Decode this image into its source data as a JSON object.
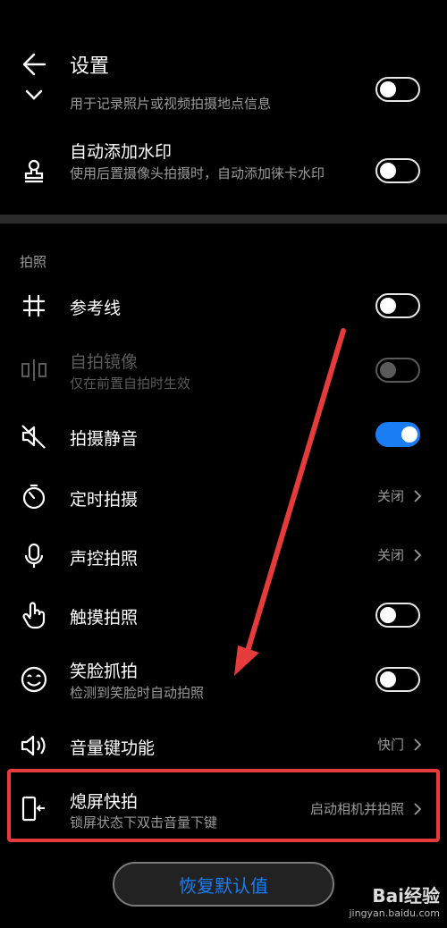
{
  "header": {
    "title": "设置"
  },
  "rows": {
    "location_sub": "用于记录照片或视频拍摄地点信息",
    "watermark": {
      "label": "自动添加水印",
      "sub": "使用后置摄像头拍摄时，自动添加徕卡水印"
    },
    "section_title": "拍照",
    "grid": {
      "label": "参考线"
    },
    "mirror": {
      "label": "自拍镜像",
      "sub": "仅在前置自拍时生效"
    },
    "mute": {
      "label": "拍摄静音"
    },
    "timer": {
      "label": "定时拍摄",
      "value": "关闭"
    },
    "voice": {
      "label": "声控拍照",
      "value": "关闭"
    },
    "touch": {
      "label": "触摸拍照"
    },
    "smile": {
      "label": "笑脸抓拍",
      "sub": "检测到笑脸时自动拍照"
    },
    "volume": {
      "label": "音量键功能",
      "value": "快门"
    },
    "snapshot": {
      "label": "熄屏快拍",
      "sub": "锁屏状态下双击音量下键",
      "value": "启动相机并拍照"
    }
  },
  "reset_label": "恢复默认值",
  "watermark_brand": {
    "main": "Bai经验",
    "sub": "jingyan.baidu.com"
  },
  "colors": {
    "accent": "#1a7df3",
    "highlight": "#e53b3b"
  }
}
